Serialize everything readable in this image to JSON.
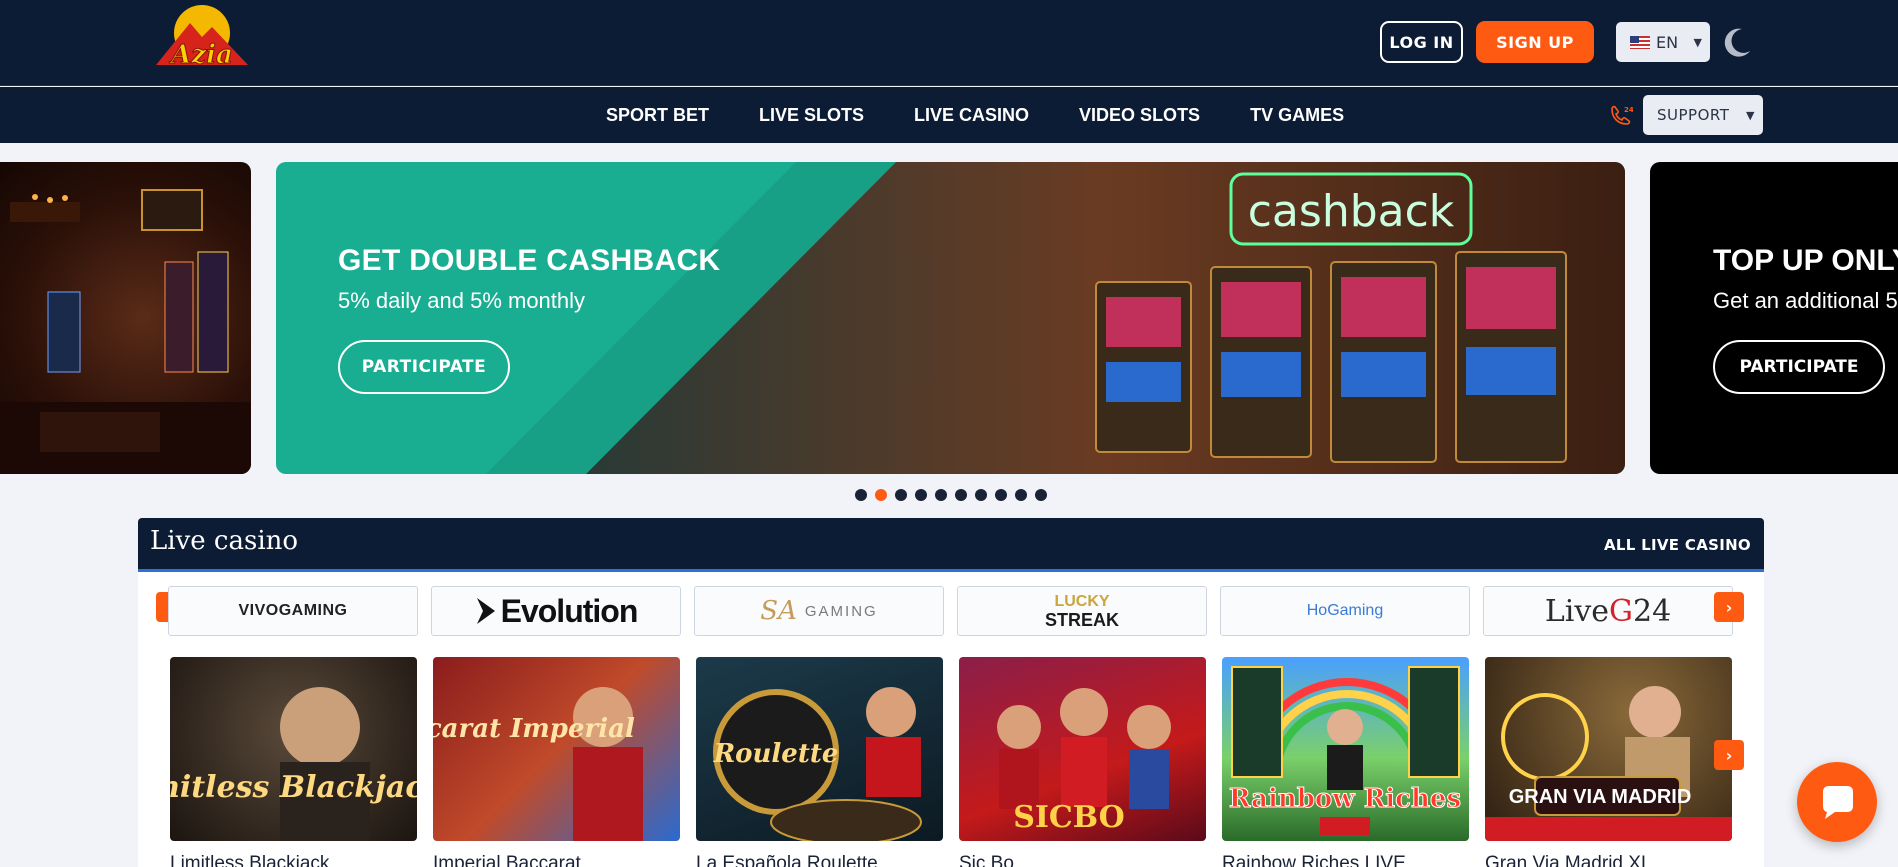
{
  "header": {
    "logo_text": "Azia",
    "login_label": "LOG IN",
    "signup_label": "SIGN UP",
    "language": "EN",
    "theme_icon": "moon-icon"
  },
  "nav": {
    "items": [
      "SPORT BET",
      "LIVE SLOTS",
      "LIVE CASINO",
      "VIDEO SLOTS",
      "TV GAMES"
    ],
    "support_label": "SUPPORT",
    "support_icon": "phone-24-icon"
  },
  "carousel": {
    "main": {
      "title": "GET DOUBLE CASHBACK",
      "subtitle": "5% daily and 5% monthly",
      "button": "PARTICIPATE",
      "sign_text": "cashback"
    },
    "next": {
      "title": "TOP UP ONLY",
      "subtitle": "Get an additional 5",
      "button": "PARTICIPATE"
    },
    "dot_count": 10,
    "active_dot": 2
  },
  "live_casino": {
    "title": "Live casino",
    "all_link": "ALL LIVE CASINO",
    "providers": {
      "vivo": "VIVOGAMING",
      "evolution": "Evolution",
      "sa": "GAMING",
      "sa_mark": "SA",
      "lucky_1": "LUCKY",
      "lucky_2": "STREAK",
      "ho": "HoGaming",
      "liveg_1": "Live",
      "liveg_2": "G",
      "liveg_3": "24"
    },
    "games": [
      {
        "name": "Limitless Blackjack",
        "art": "Limitless Blackjack"
      },
      {
        "name": "Imperial Baccarat",
        "art": "Baccarat Imperial"
      },
      {
        "name": "La Española Roulette",
        "art": "Roulette"
      },
      {
        "name": "Sic Bo",
        "art": "SICBO"
      },
      {
        "name": "Rainbow Riches LIVE",
        "art": "Rainbow Riches"
      },
      {
        "name": "Gran Via Madrid XL",
        "art": "GRAN VIA MADRID"
      }
    ]
  },
  "colors": {
    "accent": "#ff5a12",
    "navy": "#0d1c35",
    "teal": "#19ad91",
    "section_underline": "#2a72d8"
  },
  "chat_icon": "chat-bubble-icon"
}
